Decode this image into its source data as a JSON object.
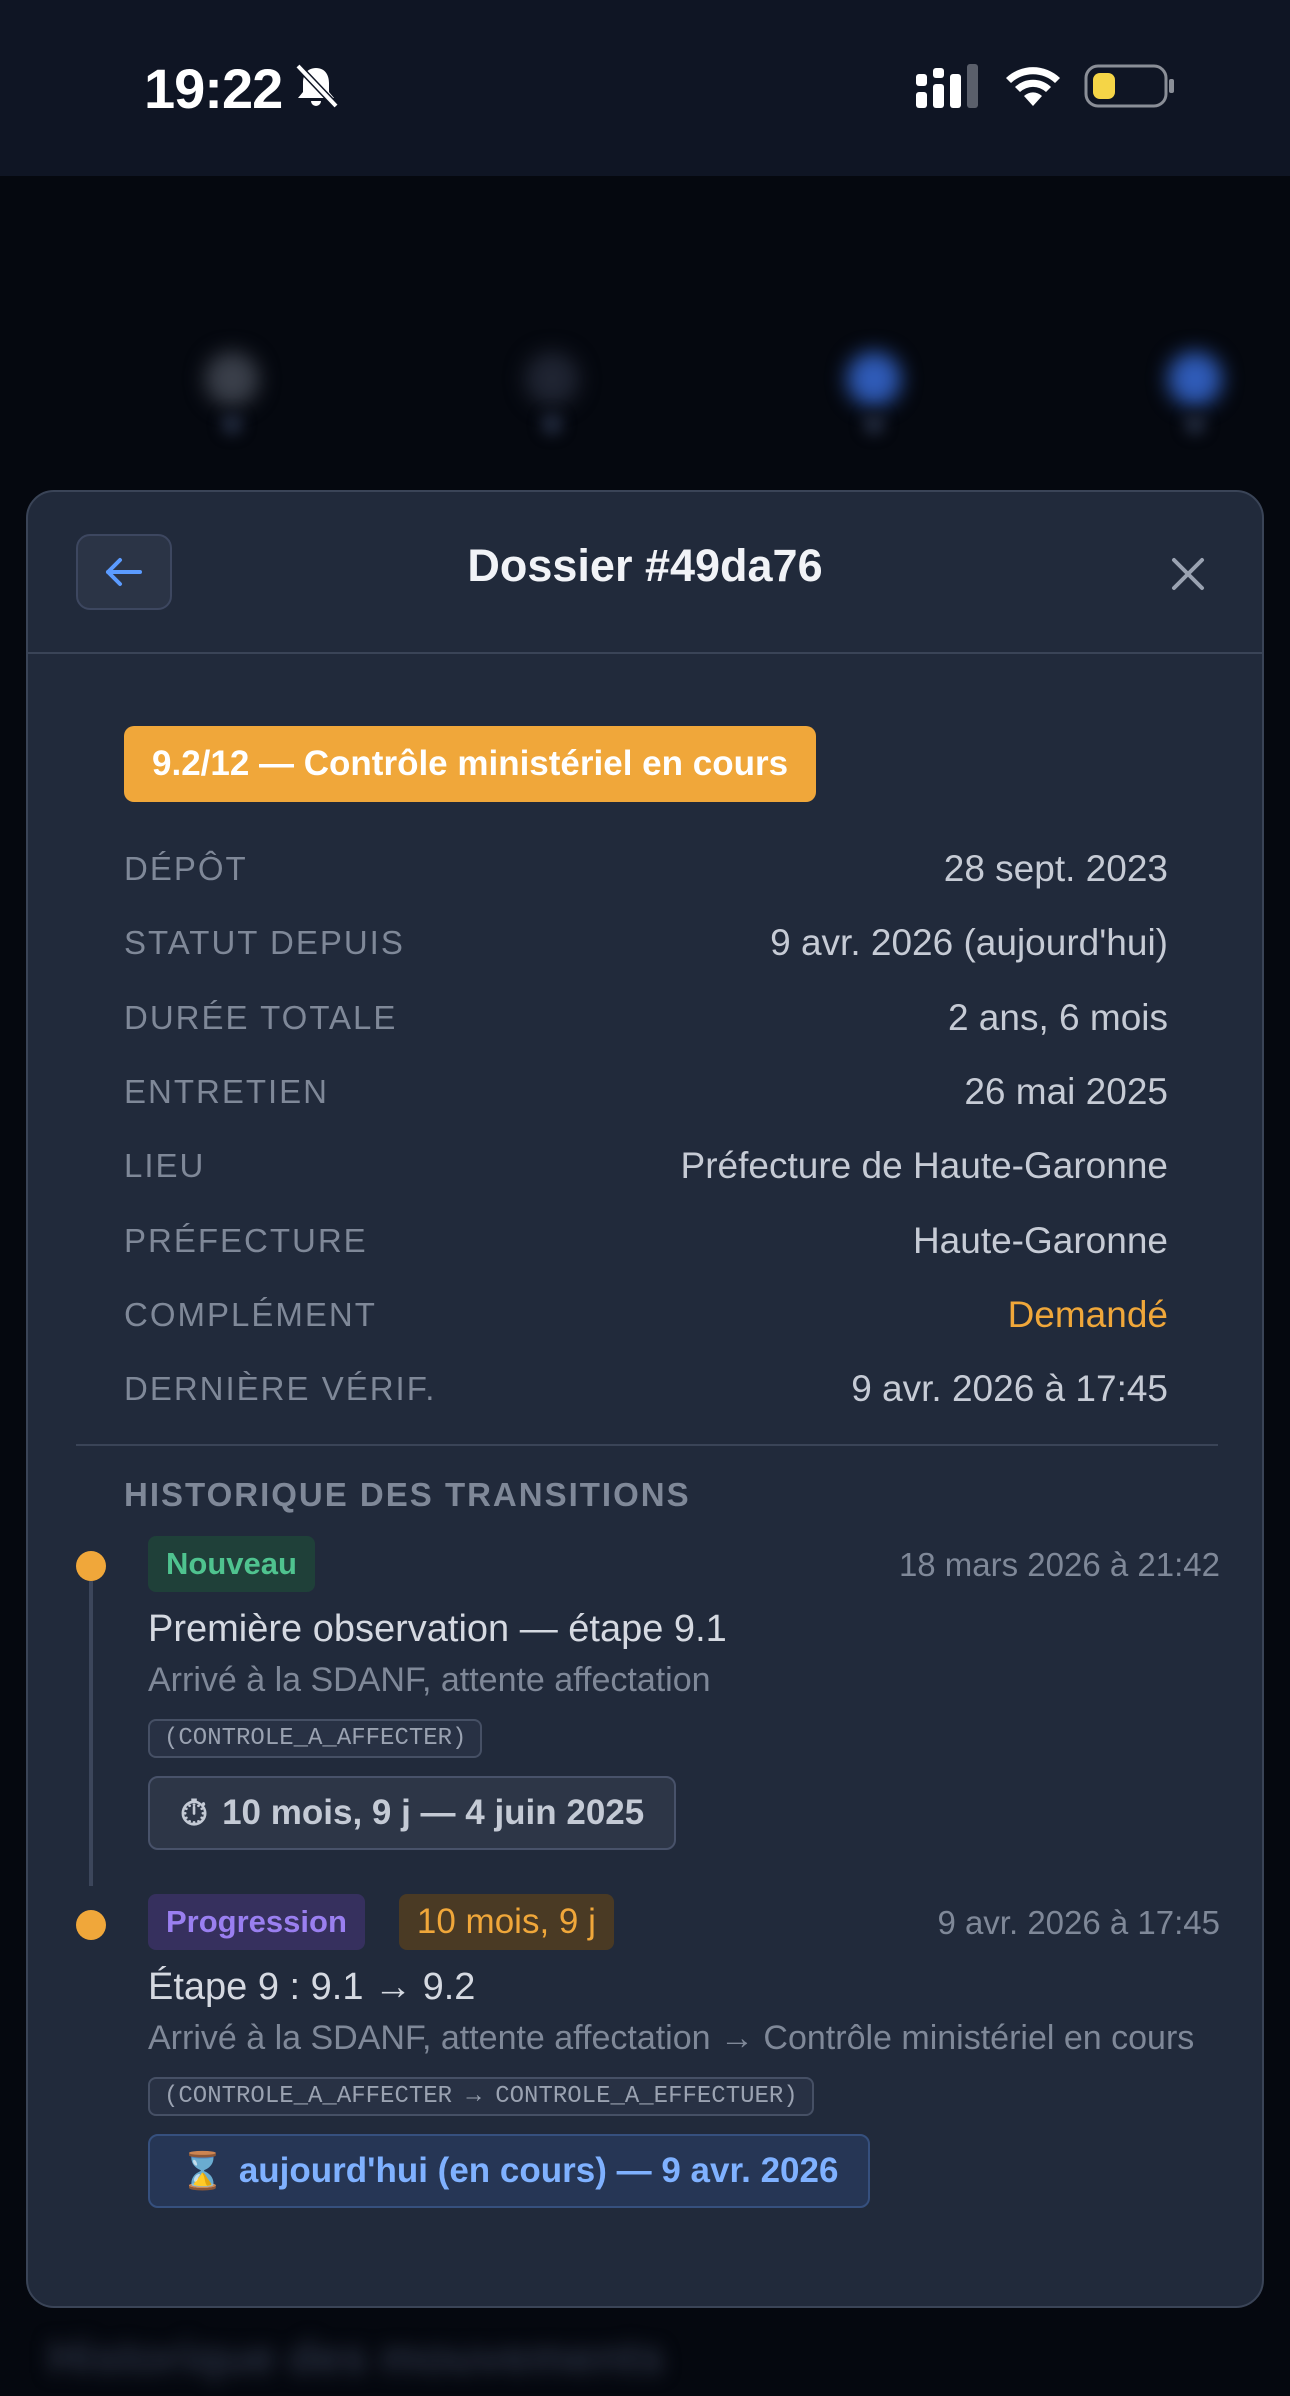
{
  "status_bar": {
    "time": "19:22"
  },
  "modal": {
    "title": "Dossier #49da76",
    "status_pill": "9.2/12 — Contrôle ministériel en cours",
    "details": [
      {
        "label": "DÉPÔT",
        "value": "28 sept. 2023"
      },
      {
        "label": "STATUT DEPUIS",
        "value": "9 avr. 2026 (aujourd'hui)"
      },
      {
        "label": "DURÉE TOTALE",
        "value": "2 ans, 6 mois"
      },
      {
        "label": "ENTRETIEN",
        "value": "26 mai 2025"
      },
      {
        "label": "LIEU",
        "value": "Préfecture de Haute-Garonne"
      },
      {
        "label": "PRÉFECTURE",
        "value": "Haute-Garonne"
      },
      {
        "label": "COMPLÉMENT",
        "value": "Demandé"
      },
      {
        "label": "DERNIÈRE VÉRIF.",
        "value": "9 avr. 2026 à 17:45"
      }
    ],
    "history_title": "HISTORIQUE DES TRANSITIONS",
    "history": [
      {
        "badge": "Nouveau",
        "time": "18 mars 2026 à 21:42",
        "title": "Première observation — étape 9.1",
        "description": "Arrivé à la SDANF, attente affectation",
        "code": "(CONTROLE_A_AFFECTER)",
        "duration": "10 mois, 9 j — 4 juin 2025",
        "duration_icon": "stopwatch-icon"
      },
      {
        "badge": "Progression",
        "badge_duration": "10 mois, 9 j",
        "time": "9 avr. 2026 à 17:45",
        "title": "Étape 9 : 9.1 → 9.2",
        "description": "Arrivé à la SDANF, attente affectation → Contrôle ministériel en cours",
        "code": "(CONTROLE_A_AFFECTER → CONTROLE_A_EFFECTUER)",
        "duration": "aujourd'hui (en cours) — 9 avr. 2026",
        "duration_icon": "hourglass-icon"
      }
    ]
  },
  "background": {
    "bottom_title": "Historique des mouvements"
  },
  "colors": {
    "accent": "#f0a73a",
    "modal_bg": "#212a3b",
    "new_badge": "#4fc38f",
    "progress_badge": "#9a7ff0",
    "current_duration": "#7fb1ff"
  }
}
